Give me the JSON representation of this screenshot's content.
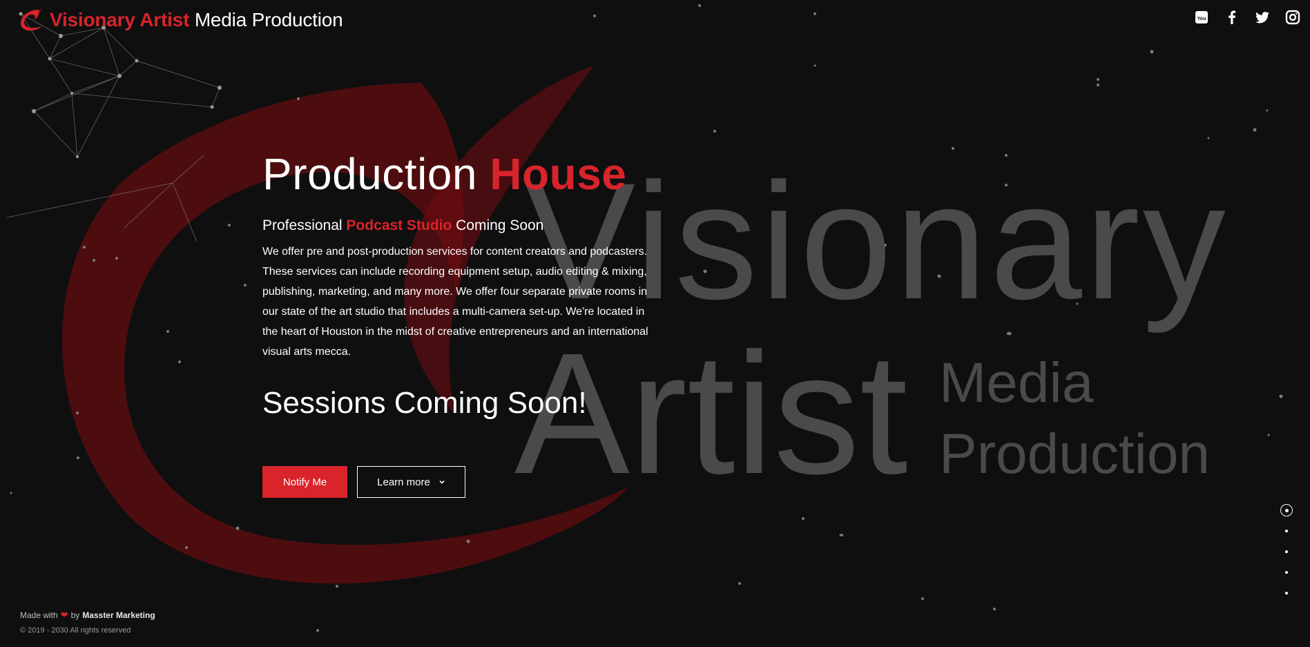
{
  "header": {
    "logo_part1": "Visionary Artist",
    "logo_part2": "Media Production",
    "social": [
      "youtube-icon",
      "facebook-icon",
      "twitter-icon",
      "instagram-icon"
    ]
  },
  "hero": {
    "title_part1": "Production",
    "title_part2": "House",
    "subtitle_part1": "Professional",
    "subtitle_part2": "Podcast Studio",
    "subtitle_part3": "Coming Soon",
    "description": "We offer pre and post-production services for content creators and podcasters. These services can include recording equipment setup, audio editing & mixing, publishing, marketing, and many more. We offer four separate private rooms in our state of the art studio that includes a multi-camera set-up. We're located in the heart of Houston in the midst of creative entrepreneurs and an international visual arts mecca.",
    "sessions": "Sessions Coming Soon!",
    "notify_label": "Notify Me",
    "learn_label": "Learn more"
  },
  "watermark": {
    "line1": "Visionary",
    "line2": "Artist",
    "line3": "Media",
    "line4": "Production"
  },
  "pager": {
    "count": 5,
    "active_index": 0
  },
  "footer": {
    "made_with": "Made with",
    "by": "by",
    "brand": "Masster Marketing",
    "copyright": "© 2019 - 2030 All rights reserved"
  },
  "colors": {
    "accent": "#d8242a",
    "background": "#0f0f10",
    "watermark": "#4a4a4a"
  }
}
